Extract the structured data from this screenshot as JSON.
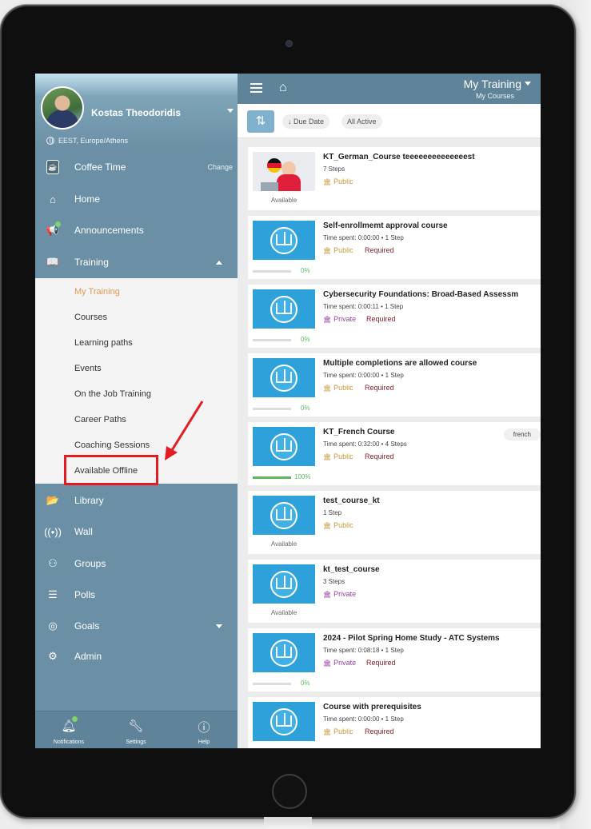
{
  "colors": {
    "accent_red": "#e41b23",
    "header_blue": "#5f8399",
    "sidebar_blue": "#6b8fa4",
    "active_orange": "#e09a55",
    "progress_green": "#5cb85c"
  },
  "profile": {
    "name": "Kostas Theodoridis",
    "timezone": "EEST, Europe/Athens"
  },
  "sidebar": {
    "coffee": {
      "label": "Coffee Time",
      "change_label": "Change",
      "icon": "coffee-cup-icon"
    },
    "top_items": [
      {
        "label": "Home",
        "icon": "home-icon"
      },
      {
        "label": "Announcements",
        "icon": "megaphone-icon"
      },
      {
        "label": "Training",
        "icon": "book-icon"
      }
    ],
    "submenu": [
      "My Training",
      "Courses",
      "Learning paths",
      "Events",
      "On the Job Training",
      "Career Paths",
      "Coaching Sessions",
      "Available Offline"
    ],
    "active_submenu_item": "My Training",
    "highlighted_submenu_item": "Available Offline",
    "bottom_items": [
      {
        "label": "Library",
        "icon": "folder-icon"
      },
      {
        "label": "Wall",
        "icon": "broadcast-icon"
      },
      {
        "label": "Groups",
        "icon": "groups-icon"
      },
      {
        "label": "Polls",
        "icon": "bars-icon"
      },
      {
        "label": "Goals",
        "icon": "target-icon"
      },
      {
        "label": "Admin",
        "icon": "admin-icon"
      }
    ],
    "footer": [
      {
        "label": "Notifications",
        "icon": "bell-icon"
      },
      {
        "label": "Settings",
        "icon": "wrench-icon"
      },
      {
        "label": "Help",
        "icon": "help-icon"
      }
    ]
  },
  "header": {
    "title": "My Training",
    "subtitle": "My Courses"
  },
  "filters": {
    "sort_icon": "sort-arrows-icon",
    "due_date": "Due Date",
    "status": "All Active"
  },
  "courses": [
    {
      "title": "KT_German_Course teeeeeeeeeeeeeest",
      "meta": "7 Steps",
      "visibility": "Public",
      "required": "",
      "under_label": "Available",
      "progress": null,
      "progress_label": "",
      "tag": "",
      "thumb": "german"
    },
    {
      "title": "Self-enrollmemt approval course",
      "meta": "Time spent: 0:00:00 • 1 Step",
      "visibility": "Public",
      "required": "Required",
      "under_label": "",
      "progress": 0,
      "progress_label": "0%",
      "tag": "",
      "thumb": "book"
    },
    {
      "title": "Cybersecurity Foundations: Broad-Based Assessm",
      "meta": "Time spent: 0:00:11 • 1 Step",
      "visibility": "Private",
      "required": "Required",
      "under_label": "",
      "progress": 0,
      "progress_label": "0%",
      "tag": "",
      "thumb": "book"
    },
    {
      "title": "Multiple completions are allowed course",
      "meta": "Time spent: 0:00:00 • 1 Step",
      "visibility": "Public",
      "required": "Required",
      "under_label": "",
      "progress": 0,
      "progress_label": "0%",
      "tag": "",
      "thumb": "book"
    },
    {
      "title": "KT_French Course",
      "meta": "Time spent: 0:32:00 • 4 Steps",
      "visibility": "Public",
      "required": "Required",
      "under_label": "",
      "progress": 100,
      "progress_label": "100%",
      "tag": "french",
      "thumb": "book"
    },
    {
      "title": "test_course_kt",
      "meta": "1 Step",
      "visibility": "Public",
      "required": "",
      "under_label": "Available",
      "progress": null,
      "progress_label": "",
      "tag": "",
      "thumb": "book"
    },
    {
      "title": "kt_test_course",
      "meta": "3 Steps",
      "visibility": "Private",
      "required": "",
      "under_label": "Available",
      "progress": null,
      "progress_label": "",
      "tag": "",
      "thumb": "book"
    },
    {
      "title": "2024 - Pilot Spring Home Study - ATC Systems",
      "meta": "Time spent: 0:08:18 • 1 Step",
      "visibility": "Private",
      "required": "Required",
      "under_label": "",
      "progress": 0,
      "progress_label": "0%",
      "tag": "",
      "thumb": "book"
    },
    {
      "title": "Course with prerequisites",
      "meta": "Time spent: 0:00:00 • 1 Step",
      "visibility": "Public",
      "required": "Required",
      "under_label": "",
      "progress": null,
      "progress_label": "",
      "tag": "",
      "thumb": "book"
    }
  ]
}
